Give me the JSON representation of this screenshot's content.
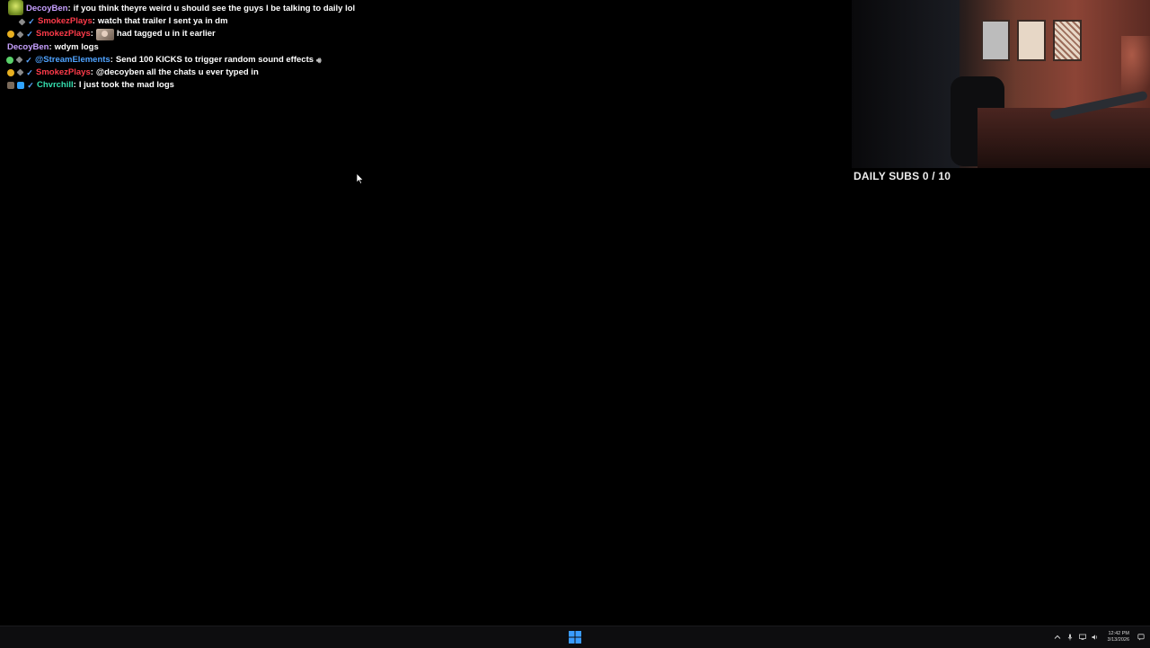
{
  "chat": {
    "messages": [
      {
        "user": "DecoyBen",
        "user_color": "#c7a0ff",
        "text": "if you think theyre weird u should see the guys I be talking to daily lol",
        "badges": [
          "sticker"
        ]
      },
      {
        "user": "SmokezPlays",
        "user_color": "#ff3b4a",
        "text": "watch that trailer I sent ya in dm",
        "badges": [
          "sword",
          "check"
        ]
      },
      {
        "user": "SmokezPlays",
        "user_color": "#ff3b4a",
        "text": "had tagged u in it earlier",
        "badges": [
          "gold",
          "sword",
          "check"
        ],
        "emote": "avatar-emote"
      },
      {
        "user": "DecoyBen",
        "user_color": "#c7a0ff",
        "text": "wdym logs",
        "badges": []
      },
      {
        "user": "@StreamElements",
        "user_color": "#4fa3ff",
        "text": "Send 100 KICKS to trigger random sound effects",
        "badges": [
          "green",
          "sword",
          "check"
        ],
        "suffix_icon": "speaker-icon"
      },
      {
        "user": "SmokezPlays",
        "user_color": "#ff3b4a",
        "text": "@decoyben all the chats u ever typed in",
        "badges": [
          "gold",
          "sword",
          "check"
        ]
      },
      {
        "user": "Chvrchill",
        "user_color": "#35e0b0",
        "text": "I just took the mad logs",
        "badges": [
          "avatar",
          "gift",
          "check"
        ]
      }
    ]
  },
  "overlay": {
    "daily_subs_label": "DAILY SUBS 0 / 10"
  },
  "taskbar": {
    "time": "12:42 PM",
    "date": "3/13/2026",
    "icons": [
      "chevron-up-icon",
      "microphone-icon",
      "network-icon",
      "volume-icon",
      "notification-icon"
    ],
    "start_icon": "windows-start-icon",
    "accent": "#2f8fff"
  }
}
